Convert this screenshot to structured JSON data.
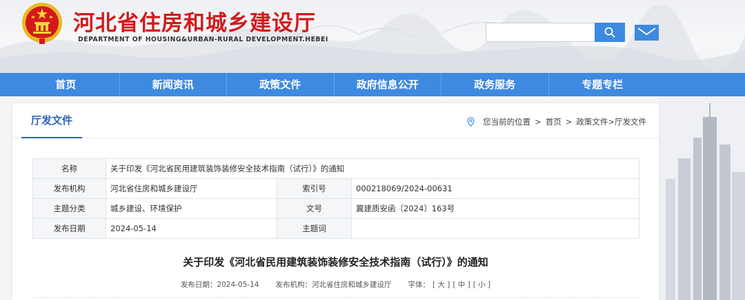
{
  "header": {
    "title": "河北省住房和城乡建设厅",
    "subtitle": "DEPARTMENT OF HOUSING&URBAN-RURAL DEVELOPMENT.HEBEI",
    "search_placeholder": "",
    "search_icon": "search-icon",
    "mail_icon": "mail-icon",
    "emblem_icon": "national-emblem-icon"
  },
  "nav": {
    "items": [
      {
        "label": "首页"
      },
      {
        "label": "新闻资讯"
      },
      {
        "label": "政策文件"
      },
      {
        "label": "政府信息公开"
      },
      {
        "label": "政务服务"
      },
      {
        "label": "专题专栏"
      }
    ]
  },
  "panel": {
    "title": "厅发文件",
    "breadcrumb": {
      "prefix": "您当前的位置",
      "sep": ">",
      "home": "首页",
      "path": "政策文件>厅发文件"
    }
  },
  "info_table": {
    "name_label": "名称",
    "name_value": "关于印发《河北省民用建筑装饰装修安全技术指南（试行）》的通知",
    "org_label": "发布机构",
    "org_value": "河北省住房和城乡建设厅",
    "index_label": "索引号",
    "index_value": "000218069/2024-00631",
    "topic_label": "主题分类",
    "topic_value": "城乡建设、环境保护",
    "docno_label": "文号",
    "docno_value": "冀建质安函〔2024〕163号",
    "date_label": "发布日期",
    "date_value": "2024-05-14",
    "keyword_label": "主题词",
    "keyword_value": ""
  },
  "article": {
    "title": "关于印发《河北省民用建筑装饰装修安全技术指南（试行）》的通知",
    "date_text": "发布日期：2024-05-14",
    "org_text": "发布机构：河北省住房和城乡建设厅",
    "font_label": "字体：",
    "font_large": "[ 大 ]",
    "font_medium": "[ 中 ]",
    "font_small": "[ 小 ]"
  },
  "colors": {
    "brand_red": "#d21a1a",
    "nav_blue": "#3e8ae0",
    "title_blue": "#2e63b8"
  }
}
